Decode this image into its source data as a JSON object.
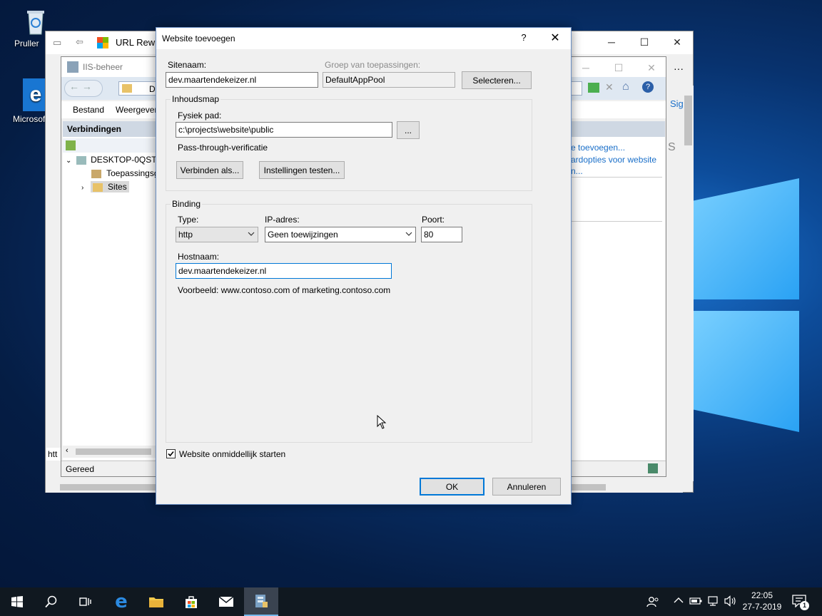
{
  "desktop": {
    "icons": [
      {
        "label": "Pruller"
      },
      {
        "label": "Microsof"
      }
    ]
  },
  "bg_url_window": {
    "title": "URL Rewri"
  },
  "iis": {
    "title": "IIS-beheer",
    "address_fragment": "D",
    "menu": [
      "Bestand",
      "Weergever"
    ],
    "connections_header": "Verbindingen",
    "tree": {
      "root": "DESKTOP-0QSTE",
      "app_pools": "Toepassingsg",
      "sites": "Sites"
    },
    "status": "Gereed",
    "left_fragment": "htt",
    "actions": [
      "e toevoegen...",
      "ardopties voor website",
      "n..."
    ],
    "edge_text": "Sig",
    "edge_text2": "S"
  },
  "dialog": {
    "title": "Website toevoegen",
    "help_symbol": "?",
    "site_name_label": "Sitenaam:",
    "site_name_value": "dev.maartendekeizer.nl",
    "app_pool_label": "Groep van toepassingen:",
    "app_pool_value": "DefaultAppPool",
    "select_button": "Selecteren...",
    "content_dir_group": "Inhoudsmap",
    "physical_path_label": "Fysiek pad:",
    "physical_path_value": "c:\\projects\\website\\public",
    "browse_button": "...",
    "passthrough_label": "Pass-through-verificatie",
    "connect_as_button": "Verbinden als...",
    "test_settings_button": "Instellingen testen...",
    "binding_group": "Binding",
    "type_label": "Type:",
    "type_value": "http",
    "ip_label": "IP-adres:",
    "ip_value": "Geen toewijzingen",
    "port_label": "Poort:",
    "port_value": "80",
    "hostname_label": "Hostnaam:",
    "hostname_value": "dev.maartendekeizer.nl",
    "example_text": "Voorbeeld: www.contoso.com of marketing.contoso.com",
    "start_checkbox_label": "Website onmiddellijk starten",
    "start_checked": true,
    "ok_button": "OK",
    "cancel_button": "Annuleren"
  },
  "taskbar": {
    "time": "22:05",
    "date": "27-7-2019",
    "notification_count": "1"
  },
  "colors": {
    "accent": "#0078d7",
    "taskbar": "#101820",
    "dialog_bg": "#f0f0f0"
  }
}
